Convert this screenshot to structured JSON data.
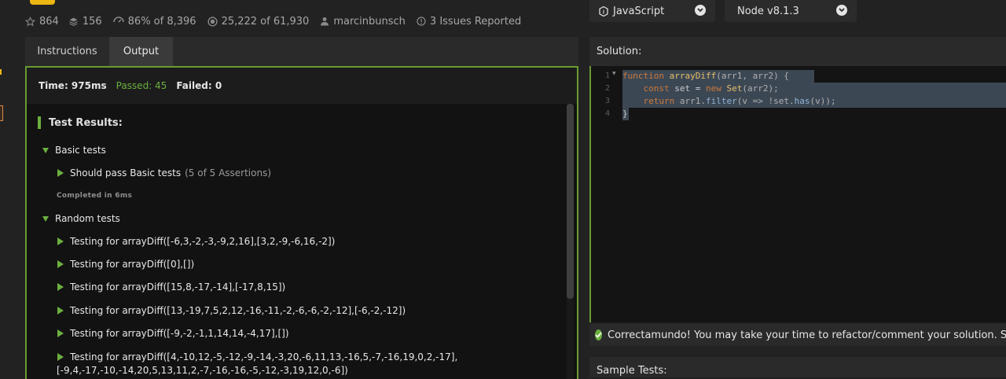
{
  "stats": {
    "stars": "864",
    "collections": "156",
    "satisfaction": "86% of 8,396",
    "completed": "25,222 of 61,930",
    "author": "marcinbunsch",
    "issues": "3 Issues Reported"
  },
  "language_select": {
    "value": "JavaScript"
  },
  "version_select": {
    "value": "Node v8.1.3"
  },
  "tabs": [
    {
      "label": "Instructions",
      "active": false
    },
    {
      "label": "Output",
      "active": true
    }
  ],
  "summary": {
    "time": "Time: 975ms",
    "passed": "Passed: 45",
    "failed": "Failed: 0"
  },
  "results": {
    "header": "Test Results:",
    "basic_group": "Basic tests",
    "basic_item": "Should pass Basic tests",
    "basic_assertions": "(5 of 5 Assertions)",
    "basic_completed": "Completed in 6ms",
    "random_group": "Random tests",
    "random_items": [
      "Testing for arrayDiff([-6,3,-2,-3,-9,2,16],[3,2,-9,-6,16,-2])",
      "Testing for arrayDiff([0],[])",
      "Testing for arrayDiff([15,8,-17,-14],[-17,8,15])",
      "Testing for arrayDiff([13,-19,7,5,2,12,-16,-11,-2,-6,-6,-2,-12],[-6,-2,-12])",
      "Testing for arrayDiff([-9,-2,-1,1,14,14,-4,17],[])",
      "Testing for arrayDiff([4,-10,12,-5,-12,-9,-14,-3,20,-6,11,13,-16,5,-7,-16,19,0,2,-17],"
    ],
    "random_item_continued": "[-9,4,-17,-10,-14,20,5,13,11,2,-7,-16,-16,-5,-12,-3,19,12,0,-6])"
  },
  "solution": {
    "title": "Solution:",
    "line_numbers": [
      "1",
      "2",
      "3",
      "4"
    ],
    "code": {
      "l1_kw": "function",
      "l1_fn": "arrayDiff",
      "l1_rest": "(arr1, arr2) {",
      "l2_kw": "const",
      "l2_var": "set",
      "l2_eq": " = ",
      "l2_new": "new",
      "l2_cls": "Set",
      "l2_rest": "(arr2);",
      "l3_kw": "return",
      "l3_a": "arr1.",
      "l3_filter": "filter",
      "l3_b": "(v => !set.",
      "l3_has": "has",
      "l3_c": "(v));",
      "l4": "}"
    }
  },
  "message": "Correctamundo! You may take your time to refactor/comment your solution. Submit",
  "sample_tests": {
    "title": "Sample Tests:"
  },
  "colors": {
    "accent_green": "#6cb040",
    "border_green": "#6a9b32",
    "selection": "#3c4754"
  }
}
